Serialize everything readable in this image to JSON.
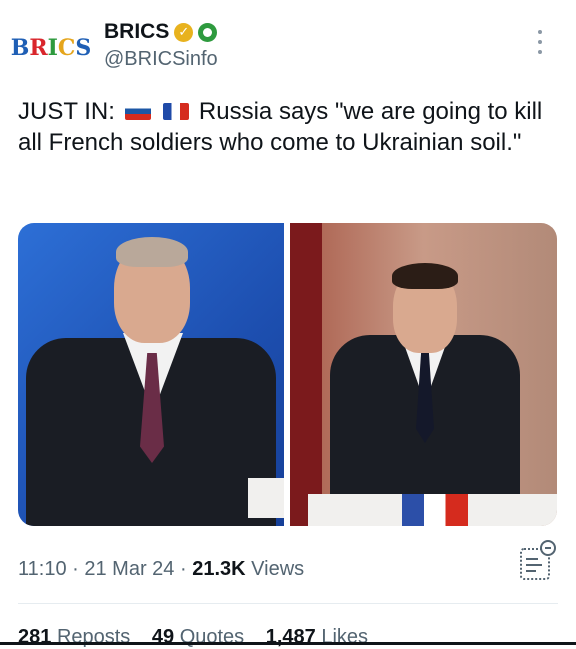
{
  "account": {
    "name": "BRICS",
    "handle": "@BRICSinfo",
    "logo_letters": [
      "B",
      "R",
      "I",
      "C",
      "S"
    ],
    "verified_icon": "gold-check-badge-icon",
    "affiliate_icon": "affiliate-badge-icon"
  },
  "tweet": {
    "prefix": "JUST IN:",
    "flags": [
      "russia-flag-icon",
      "france-flag-icon"
    ],
    "body": "Russia says \"we are going to kill all French soldiers who come to Ukrainian soil.\""
  },
  "meta": {
    "time": "11:10",
    "date": "21 Mar 24",
    "views_count": "21.3K",
    "views_label": "Views"
  },
  "stats": {
    "reposts_count": "281",
    "reposts_label": "Reposts",
    "quotes_count": "49",
    "quotes_label": "Quotes",
    "likes_count": "1,487",
    "likes_label": "Likes"
  },
  "colors": {
    "text": "#0f1419",
    "secondary": "#536471",
    "verified_gold": "#e8b21e"
  }
}
